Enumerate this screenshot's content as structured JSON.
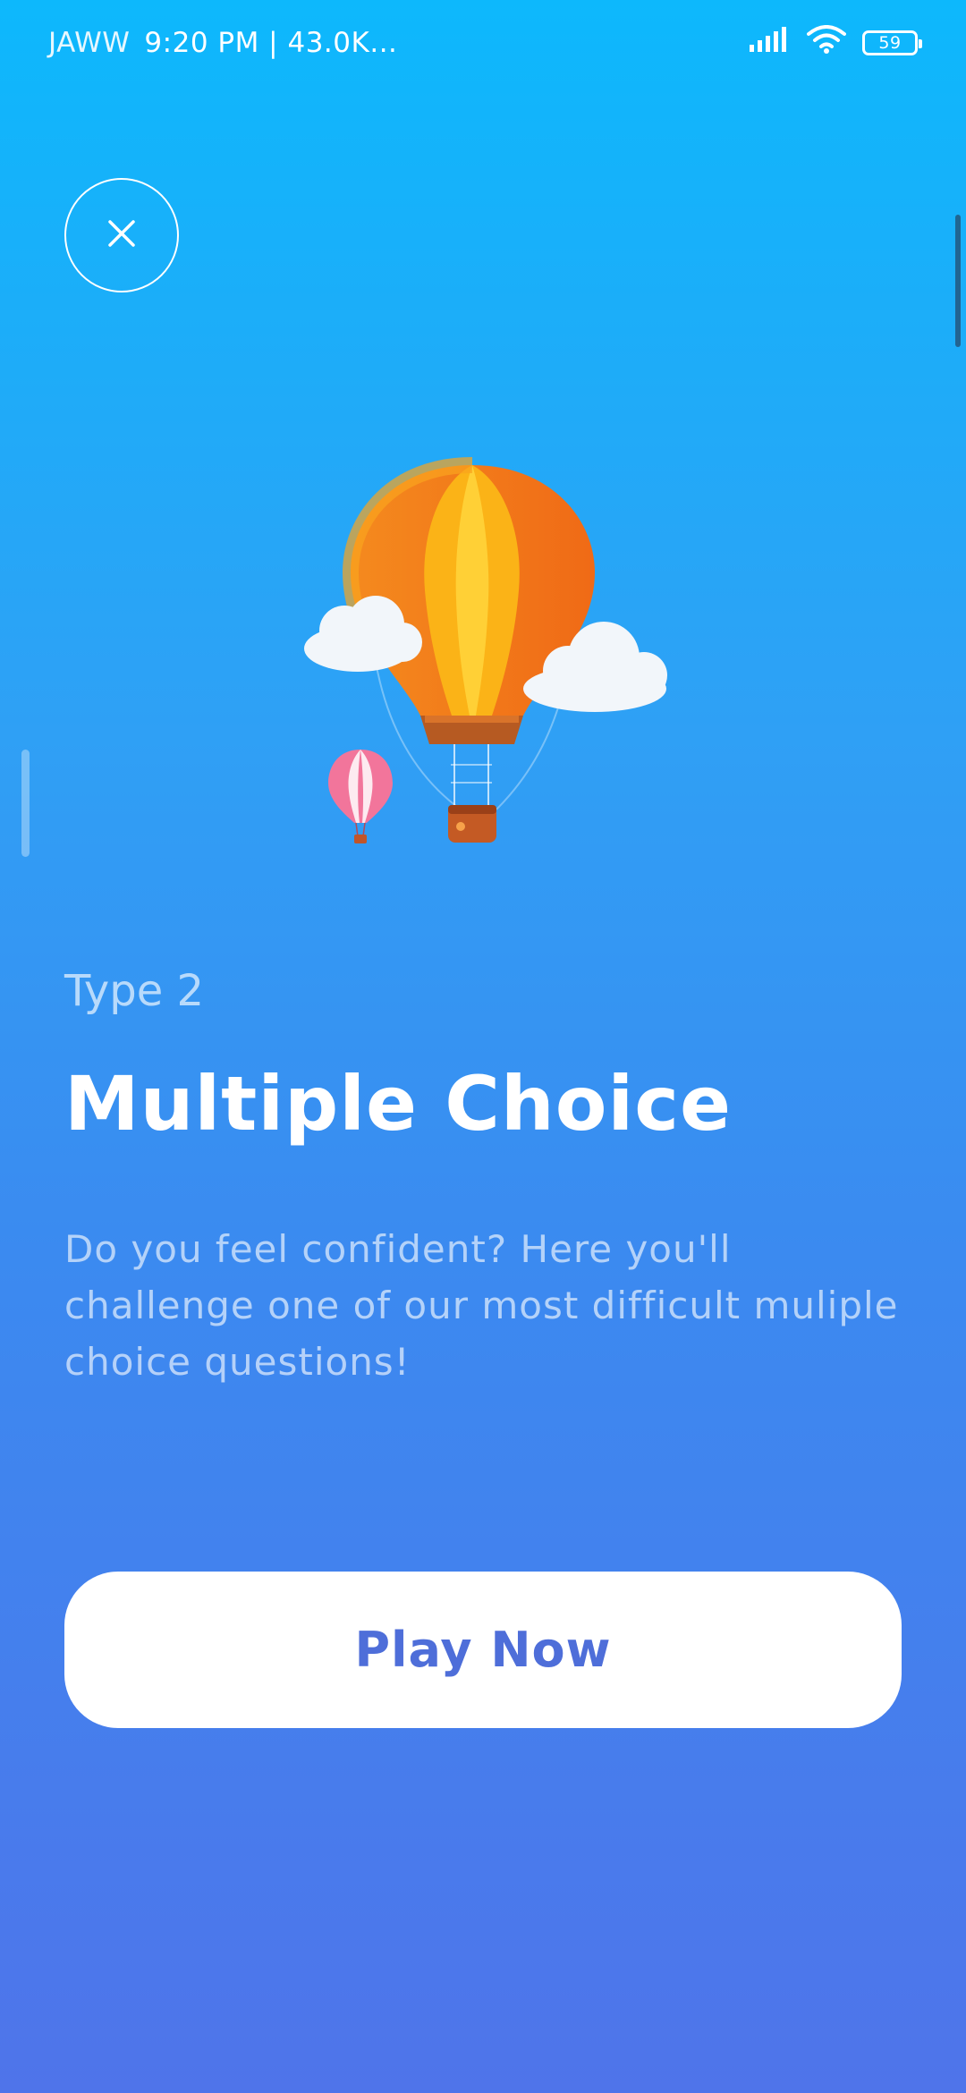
{
  "status_bar": {
    "carrier": "JAWW",
    "info": "9:20 PM | 43.0K...",
    "battery": "59",
    "icons": [
      "signal-icon",
      "wifi-icon",
      "battery-icon"
    ]
  },
  "header": {
    "close_icon": "close-icon"
  },
  "illustration": {
    "name": "hot-air-balloon-illustration"
  },
  "content": {
    "type_label": "Type 2",
    "title": "Multiple Choice",
    "description": "Do you feel confident? Here you'll challenge one of our most difficult muliple choice questions!"
  },
  "actions": {
    "play_label": "Play Now"
  },
  "colors": {
    "gradient_top": "#0DB8FC",
    "gradient_bottom": "#4F74EA",
    "button_text": "#4E6ED9",
    "button_bg": "#FFFFFF"
  }
}
